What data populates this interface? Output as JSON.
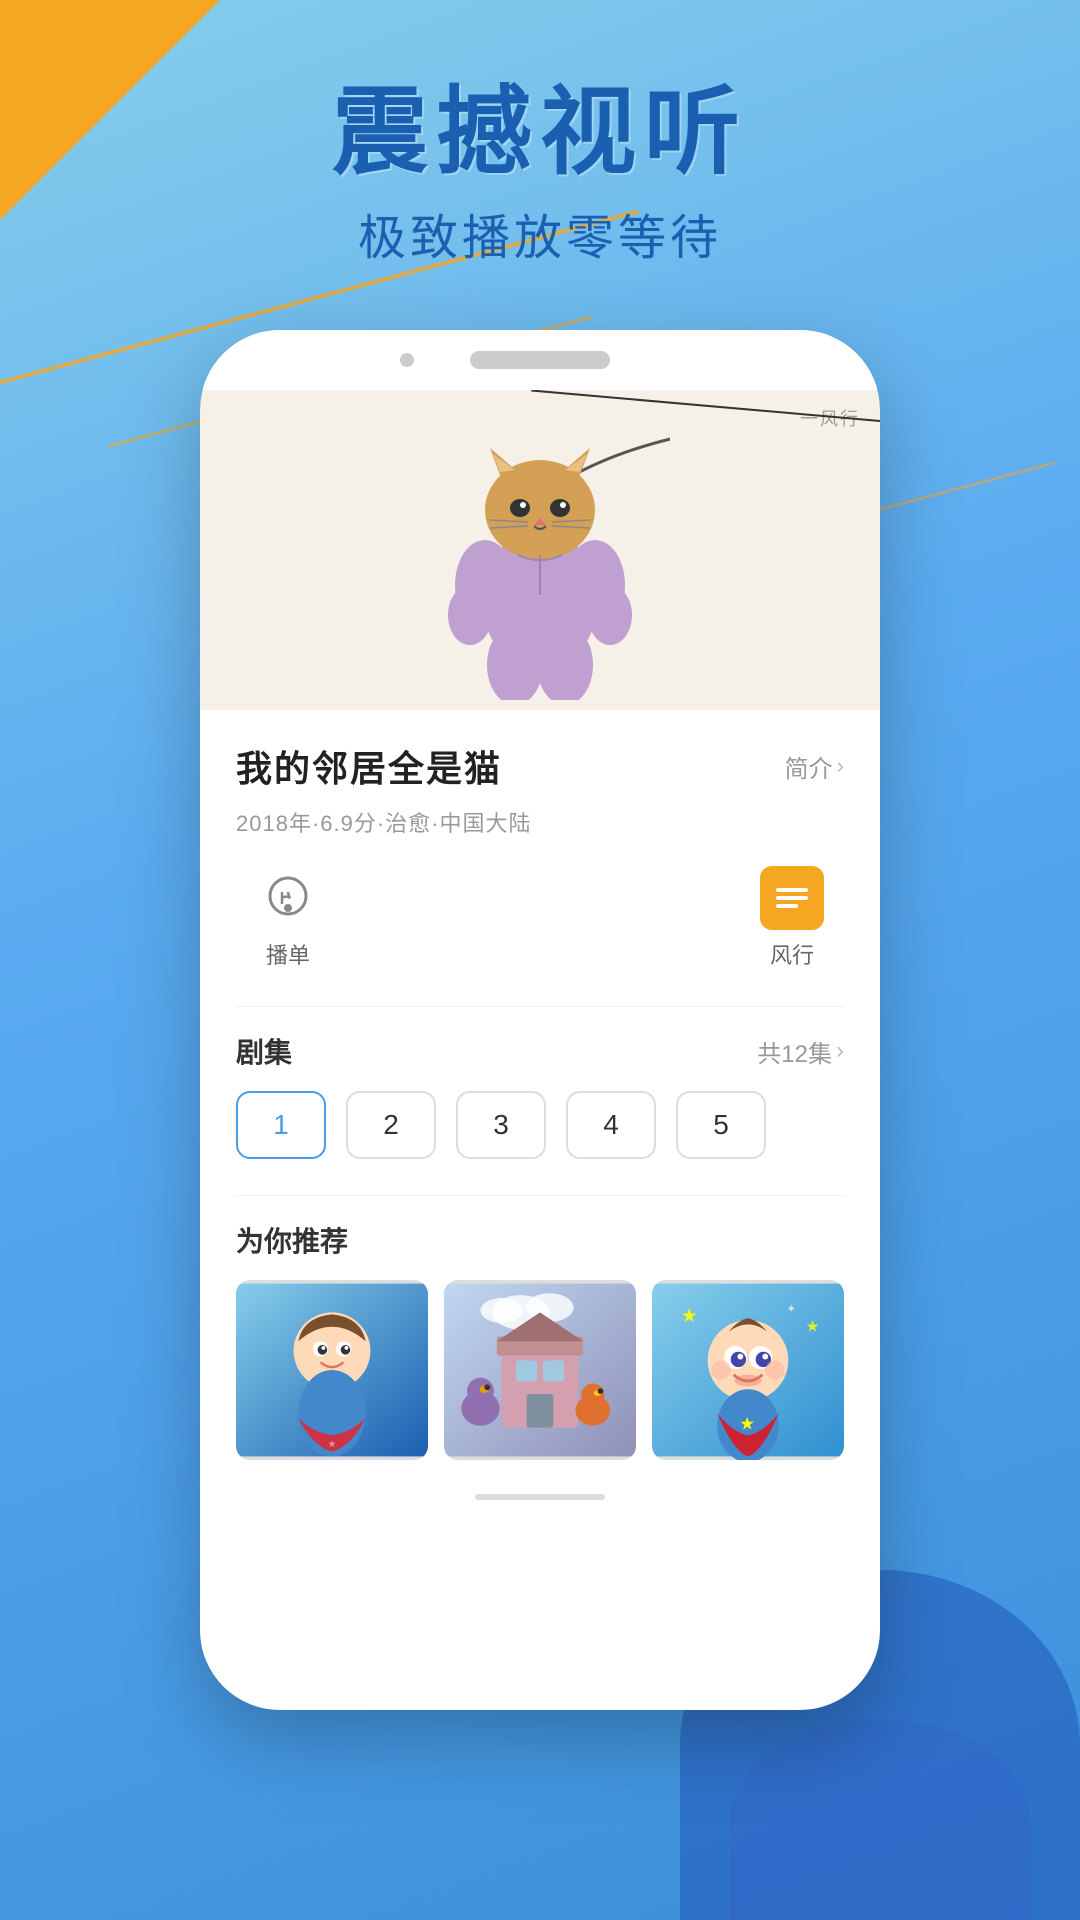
{
  "background": {
    "primary_color": "#87CEEB",
    "secondary_color": "#4A9EE8",
    "accent_color": "#F5A623"
  },
  "header": {
    "main_title": "震撼视听",
    "sub_title": "极致播放零等待"
  },
  "phone": {
    "video": {
      "watermark": "一风行",
      "thumbnail_bg": "#f5f0e8"
    },
    "show": {
      "title": "我的邻居全是猫",
      "intro_label": "简介",
      "meta": "2018年·6.9分·治愈·中国大陆"
    },
    "actions": [
      {
        "id": "playlist",
        "label": "播单",
        "icon": "♡"
      },
      {
        "id": "fengxing",
        "label": "风行",
        "icon": "≡"
      }
    ],
    "episodes": {
      "label": "剧集",
      "total_label": "共12集",
      "items": [
        1,
        2,
        3,
        4,
        5
      ],
      "active": 1
    },
    "recommendations": {
      "label": "为你推荐",
      "items": [
        {
          "id": 1,
          "emoji": "🧒"
        },
        {
          "id": 2,
          "emoji": "🦆"
        },
        {
          "id": 3,
          "emoji": "👶"
        }
      ]
    }
  }
}
